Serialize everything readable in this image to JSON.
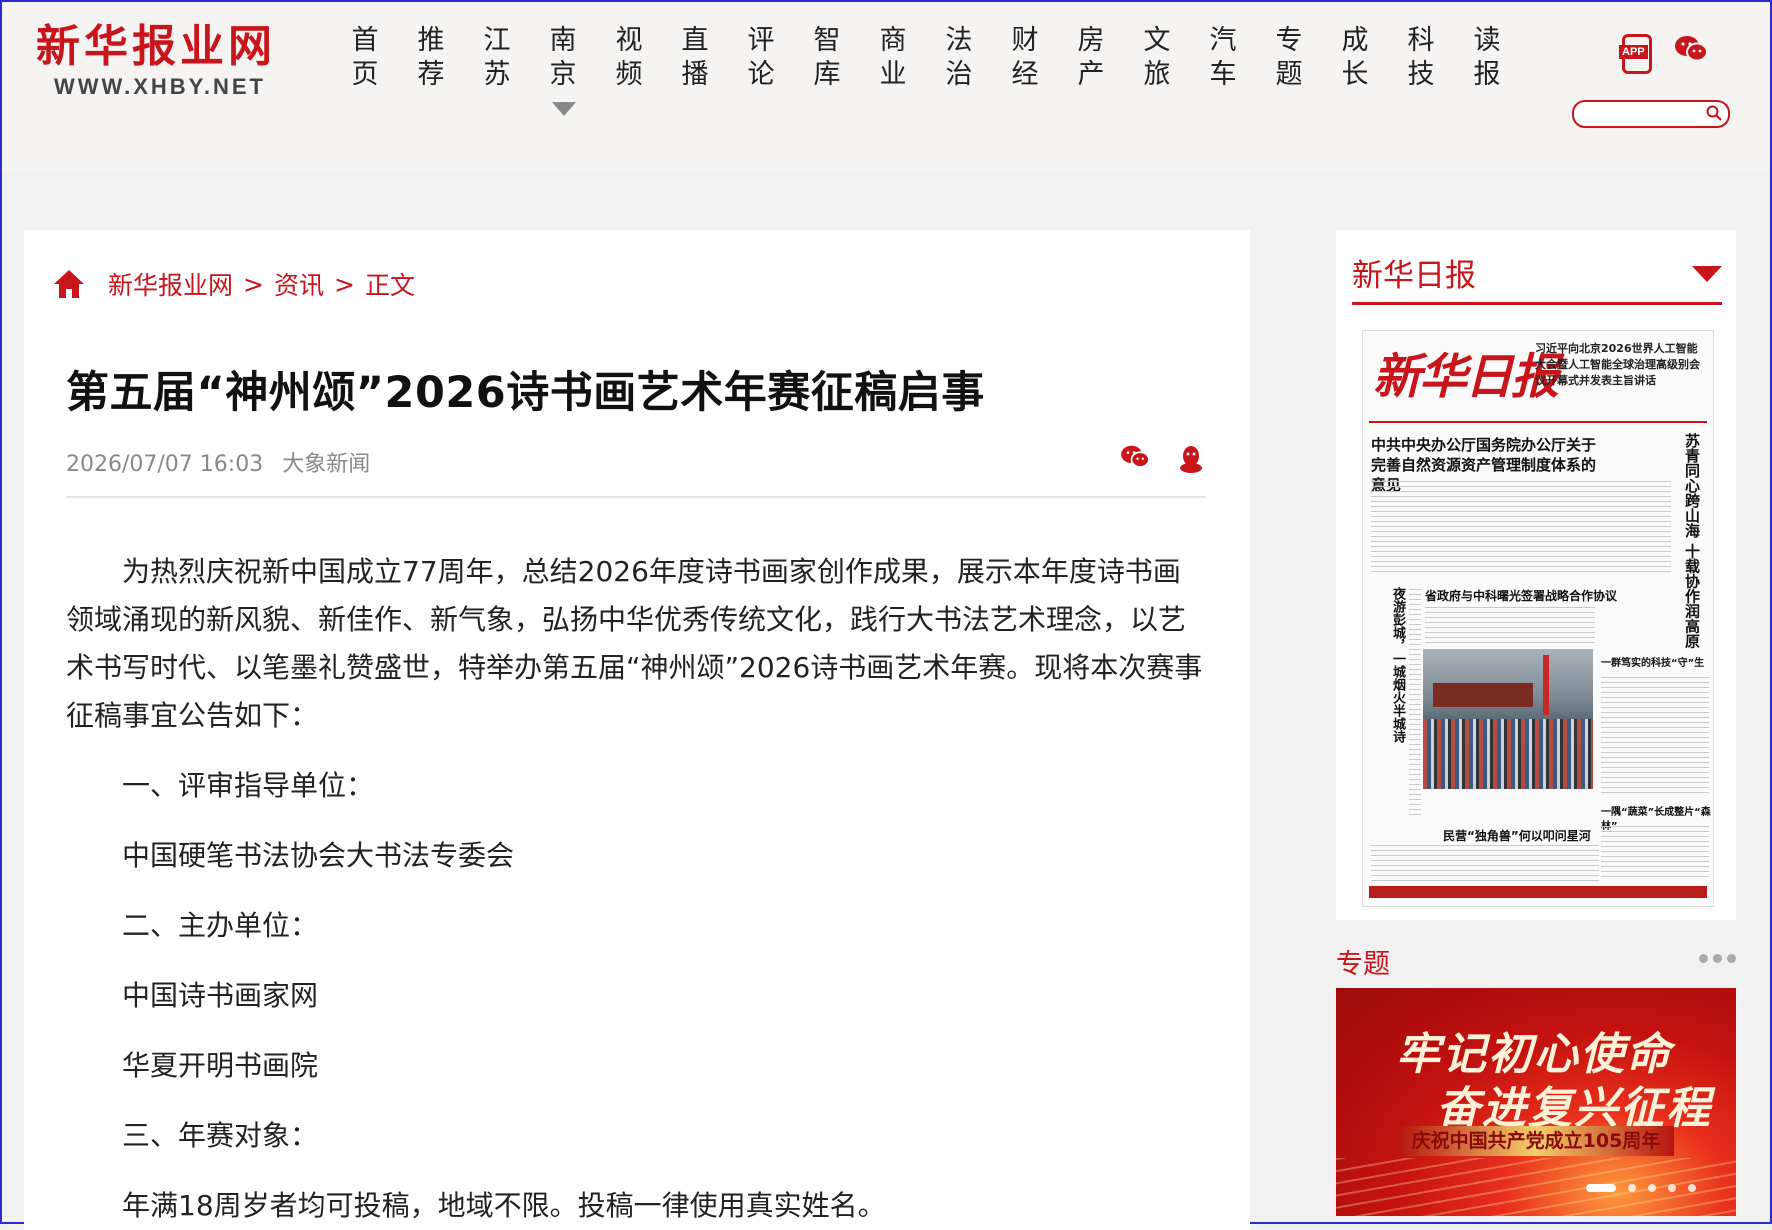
{
  "header": {
    "logo_cn": "新华报业网",
    "logo_en": "WWW.XHBY.NET",
    "nav": [
      {
        "top": "首",
        "bottom": "页"
      },
      {
        "top": "推",
        "bottom": "荐"
      },
      {
        "top": "江",
        "bottom": "苏"
      },
      {
        "top": "南",
        "bottom": "京"
      },
      {
        "top": "视",
        "bottom": "频"
      },
      {
        "top": "直",
        "bottom": "播"
      },
      {
        "top": "评",
        "bottom": "论"
      },
      {
        "top": "智",
        "bottom": "库"
      },
      {
        "top": "商",
        "bottom": "业"
      },
      {
        "top": "法",
        "bottom": "治"
      },
      {
        "top": "财",
        "bottom": "经"
      },
      {
        "top": "房",
        "bottom": "产"
      },
      {
        "top": "文",
        "bottom": "旅"
      },
      {
        "top": "汽",
        "bottom": "车"
      },
      {
        "top": "专",
        "bottom": "题"
      },
      {
        "top": "成",
        "bottom": "长"
      },
      {
        "top": "科",
        "bottom": "技"
      },
      {
        "top": "读",
        "bottom": "报"
      }
    ],
    "app_badge": "APP",
    "search_placeholder": "",
    "icons": [
      "app-phone-icon",
      "wechat-icon",
      "search-icon",
      "chevron-down-icon"
    ]
  },
  "breadcrumb": {
    "home": "新华报业网",
    "section": "资讯",
    "current": "正文",
    "sep": ">"
  },
  "article": {
    "title": "第五届“神州颂”2026诗书画艺术年赛征稿启事",
    "date": "2026/07/07 16:03",
    "source": "大象新闻",
    "lead": "为热烈庆祝新中国成立77周年，总结2026年度诗书画家创作成果，展示本年度诗书画领域涌现的新风貌、新佳作、新气象，弘扬中华优秀传统文化，践行大书法艺术理念，以艺术书写时代、以笔墨礼赞盛世，特举办第五届“神州颂”2026诗书画艺术年赛。现将本次赛事征稿事宜公告如下：",
    "sections": [
      "一、评审指导单位：",
      "中国硬笔书法协会大书法专委会",
      "二、主办单位：",
      "中国诗书画家网",
      "华夏开明书画院",
      "三、年赛对象：",
      "年满18周岁者均可投稿，地域不限。投稿一律使用真实姓名。"
    ]
  },
  "sidebar": {
    "paper_title": "新华日报",
    "paper": {
      "masthead": "新华日报",
      "top_headline": "习近平向北京2026世界人工智能大会暨人工智能全球治理高级别会议开幕式并发表主旨讲话",
      "headline": "中共中央办公厅国务院办公厅关于完善自然资源资产管理制度体系的意见",
      "vertical_headline": "苏青同心跨山海 十载协作润高原",
      "vertical_headline2": "夜游彭城，一城烟火半城诗",
      "sub_headline": "省政府与中科曙光签署战略合作协议",
      "sub_headline2": "民营“独角兽”何以叩问星河",
      "side_headline": "一群笃实的科技“守”生",
      "side_headline2": "一隅“蔬菜”长成整片“森林”"
    },
    "topic_title": "专题",
    "banner": {
      "line1": "牢记初心使命",
      "line2": "奋进复兴征程",
      "line3": "庆祝中国共产党成立105周年"
    }
  }
}
